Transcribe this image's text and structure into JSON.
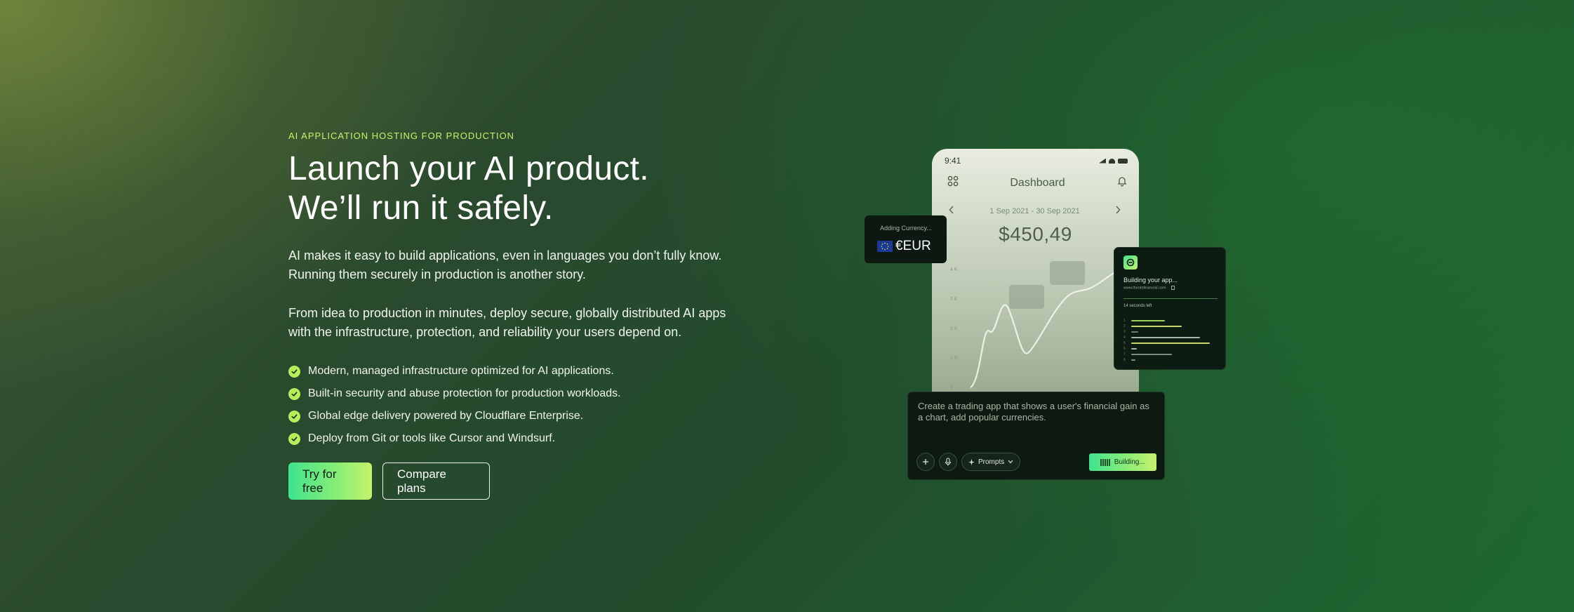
{
  "hero": {
    "eyebrow": "AI APPLICATION HOSTING FOR PRODUCTION",
    "headline_line1": "Launch your AI product.",
    "headline_line2": "We’ll run it safely.",
    "para1": "AI makes it easy to build applications, even in languages you don’t fully know. Running them securely in production is another story.",
    "para2": "From idea to production in minutes, deploy secure, globally distributed AI apps with the infrastructure, protection, and reliability your users depend on.",
    "features": [
      "Modern, managed infrastructure optimized for AI applications.",
      "Built-in security and abuse protection for production workloads.",
      "Global edge delivery powered by Cloudflare Enterprise.",
      "Deploy from Git or tools like Cursor and Windsurf."
    ],
    "cta_primary": "Try for free",
    "cta_secondary": "Compare plans"
  },
  "phone": {
    "time": "9:41",
    "title": "Dashboard",
    "date_range": "1 Sep 2021 - 30 Sep 2021",
    "amount": "$450,49",
    "y_ticks": [
      "4 K",
      "3 K",
      "2 K",
      "1 K",
      "0"
    ]
  },
  "currency_card": {
    "label": "Adding Currency...",
    "value": "€EUR"
  },
  "build_card": {
    "title": "Building your app...",
    "url": "www.theotofinancial.com",
    "time_left": "14 seconds left"
  },
  "prompt": {
    "text": "Create a trading app that shows a user's financial gain as a chart, add popular currencies.",
    "prompts_label": "Prompts",
    "building_label": "Building..."
  },
  "colors": {
    "accent_lime": "#c6f36b",
    "accent_green": "#3fe38e",
    "check_fill": "#b5ef5a"
  },
  "icons": [
    "check-icon",
    "grid-icon",
    "bell-icon",
    "chevron-left-icon",
    "chevron-right-icon",
    "plus-icon",
    "mic-icon",
    "sparkle-icon",
    "chevron-down-icon",
    "eu-flag-icon",
    "copy-icon",
    "bars-icon"
  ]
}
